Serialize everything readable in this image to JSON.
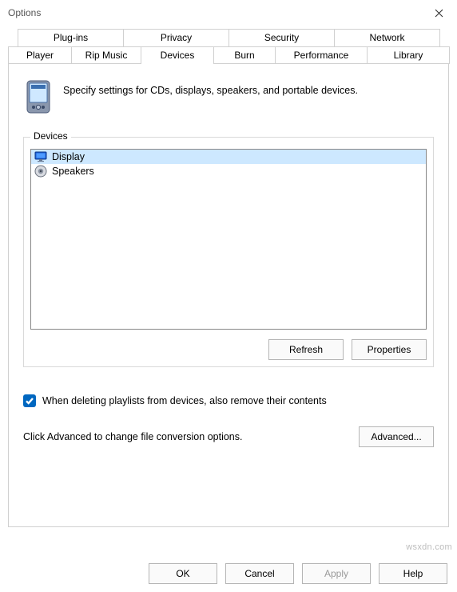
{
  "window": {
    "title": "Options"
  },
  "tabs_top": [
    "Plug-ins",
    "Privacy",
    "Security",
    "Network"
  ],
  "tabs_bottom": [
    "Player",
    "Rip Music",
    "Devices",
    "Burn",
    "Performance",
    "Library"
  ],
  "active_tab": "Devices",
  "intro": "Specify settings for CDs, displays, speakers, and portable devices.",
  "group_label": "Devices",
  "devices": [
    {
      "name": "Display",
      "icon": "monitor",
      "selected": true
    },
    {
      "name": "Speakers",
      "icon": "speaker",
      "selected": false
    }
  ],
  "buttons": {
    "refresh": "Refresh",
    "properties": "Properties",
    "advanced": "Advanced...",
    "ok": "OK",
    "cancel": "Cancel",
    "apply": "Apply",
    "help": "Help"
  },
  "checkbox": {
    "checked": true,
    "label": "When deleting playlists from devices, also remove their contents"
  },
  "advanced_text": "Click Advanced to change file conversion options.",
  "watermark": "wsxdn.com"
}
